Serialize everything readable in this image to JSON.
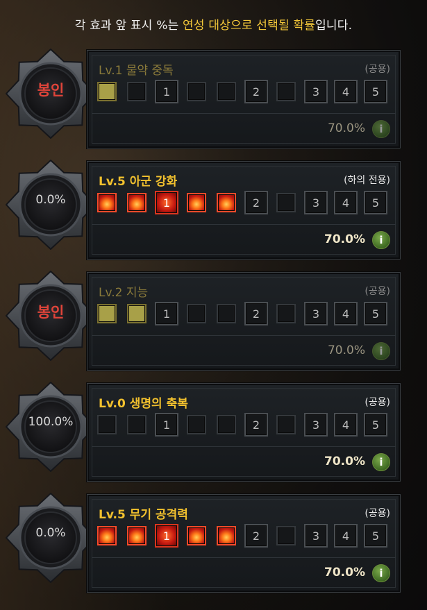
{
  "header": {
    "prefix": "각 효과 앞 표시 %는 ",
    "highlight": "연성 대상으로 선택될 확률",
    "suffix": "입니다."
  },
  "info_icon": "i",
  "cards": [
    {
      "title": "Lv.1 물약 중독",
      "tag": "(공용)",
      "emblem": "봉인",
      "sealed": true,
      "level": 1,
      "percent": "70.0%",
      "fill_color": "yellow",
      "slot_numbers": [
        "",
        "",
        "1",
        "",
        "",
        "2",
        "",
        "3",
        "4",
        "5"
      ]
    },
    {
      "title": "Lv.5 아군 강화",
      "tag": "(하의 전용)",
      "emblem": "0.0%",
      "sealed": false,
      "level": 5,
      "percent": "70.0%",
      "fill_color": "red",
      "slot_numbers": [
        "",
        "",
        "1",
        "",
        "",
        "2",
        "",
        "3",
        "4",
        "5"
      ]
    },
    {
      "title": "Lv.2 지능",
      "tag": "(공용)",
      "emblem": "봉인",
      "sealed": true,
      "level": 2,
      "percent": "70.0%",
      "fill_color": "yellow",
      "slot_numbers": [
        "",
        "",
        "1",
        "",
        "",
        "2",
        "",
        "3",
        "4",
        "5"
      ]
    },
    {
      "title": "Lv.0 생명의 축복",
      "tag": "(공용)",
      "emblem": "100.0%",
      "sealed": false,
      "level": 0,
      "percent": "70.0%",
      "fill_color": "yellow",
      "slot_numbers": [
        "",
        "",
        "1",
        "",
        "",
        "2",
        "",
        "3",
        "4",
        "5"
      ]
    },
    {
      "title": "Lv.5 무기 공격력",
      "tag": "(공용)",
      "emblem": "0.0%",
      "sealed": false,
      "level": 5,
      "percent": "70.0%",
      "fill_color": "red",
      "slot_numbers": [
        "",
        "",
        "1",
        "",
        "",
        "2",
        "",
        "3",
        "4",
        "5"
      ]
    }
  ],
  "colors": {
    "title_gold": "#f2c12e",
    "sealed_red": "#e0443a",
    "slot_yellow": "#d8cf70",
    "slot_red": "#c41810",
    "info_green": "#4a7a2a"
  }
}
